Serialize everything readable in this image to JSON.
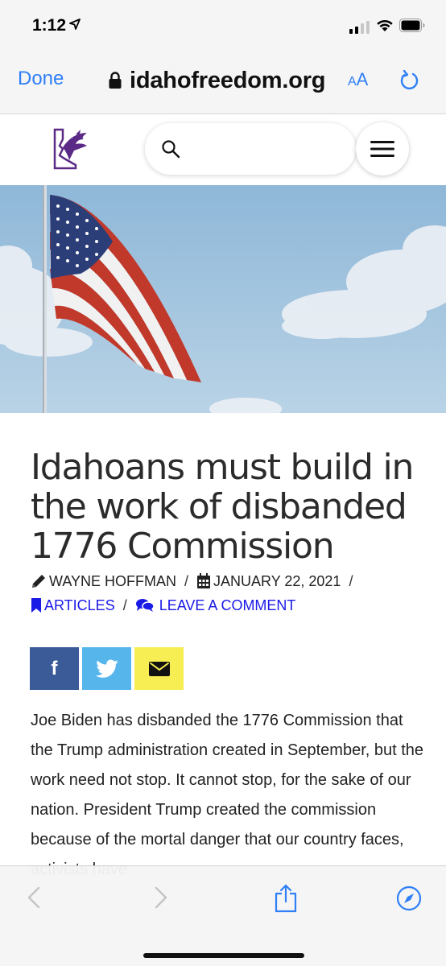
{
  "status_bar": {
    "time": "1:12"
  },
  "browser": {
    "done_label": "Done",
    "url": "idahofreedom.org",
    "text_size_small": "A",
    "text_size_big": "A"
  },
  "site": {
    "search_placeholder": ""
  },
  "article": {
    "title": "Idahoans must build in the work of disbanded 1776 Commission",
    "author": "WAYNE HOFFMAN",
    "date": "JANUARY 22, 2021",
    "category": "ARTICLES",
    "comment_link": "LEAVE A COMMENT",
    "separator": "/",
    "body": "Joe Biden has disbanded the 1776 Commission that the Trump administration created in September, but the work need not stop. It cannot stop, for the sake of our nation. President Trump created the commission because of the mortal danger that our country faces, activists have"
  },
  "share": {
    "facebook_glyph": "f",
    "colors": {
      "facebook": "#3b5b98",
      "twitter": "#56b6ec",
      "email": "#f6ee52"
    }
  },
  "colors": {
    "link": "#1a1ae6",
    "safari_accent": "#2f7ff7",
    "brand_purple": "#5b2a86"
  }
}
